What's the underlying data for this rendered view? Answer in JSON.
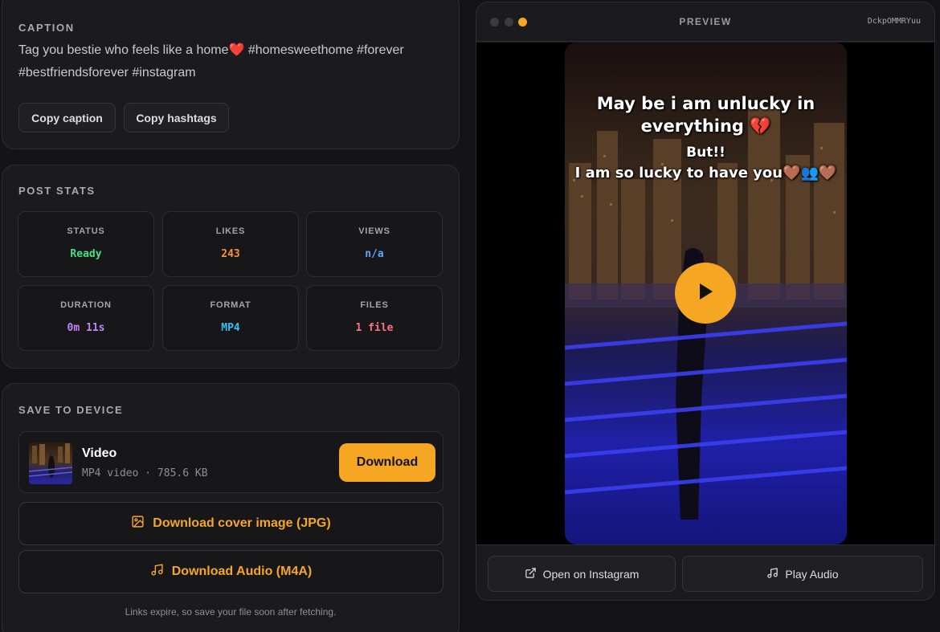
{
  "caption": {
    "title": "CAPTION",
    "text": "Tag you bestie who feels like a home",
    "heart": "❤️",
    "hashtags": "#homesweethome #forever #bestfriendsforever #instagram",
    "copy_caption_label": "Copy caption",
    "copy_hashtags_label": "Copy hashtags"
  },
  "stats": {
    "title": "POST STATS",
    "items": [
      {
        "label": "STATUS",
        "value": "Ready",
        "color": "#4ade80"
      },
      {
        "label": "LIKES",
        "value": "243",
        "color": "#fb923c"
      },
      {
        "label": "VIEWS",
        "value": "n/a",
        "color": "#60a5fa"
      },
      {
        "label": "DURATION",
        "value": "0m 11s",
        "color": "#c084fc"
      },
      {
        "label": "FORMAT",
        "value": "MP4",
        "color": "#38bdf8"
      },
      {
        "label": "FILES",
        "value": "1 file",
        "color": "#fb7185"
      }
    ]
  },
  "save": {
    "title": "SAVE TO DEVICE",
    "file_name": "Video",
    "file_meta": "MP4 video · 785.6 KB",
    "download_label": "Download",
    "cover_label": "Download cover image (JPG)",
    "audio_label": "Download Audio (M4A)",
    "footnote": "Links expire, so save your file soon after fetching."
  },
  "preview": {
    "label": "PREVIEW",
    "post_id": "DckpOMMRYuu",
    "overlay_line1": "May be i am unlucky in",
    "overlay_line2": "everything 💔",
    "overlay_line3": "But!!",
    "overlay_line4": "I am so lucky to have you🤎👥🤎",
    "open_label": "Open on Instagram",
    "play_audio_label": "Play Audio"
  },
  "colors": {
    "accent": "#f5a623",
    "window_dot_1": "#3a3a40",
    "window_dot_2": "#3a3a40",
    "window_dot_3": "#f5a623"
  },
  "icons": [
    "image-icon",
    "music-note-icon",
    "external-link-icon",
    "play-icon"
  ]
}
